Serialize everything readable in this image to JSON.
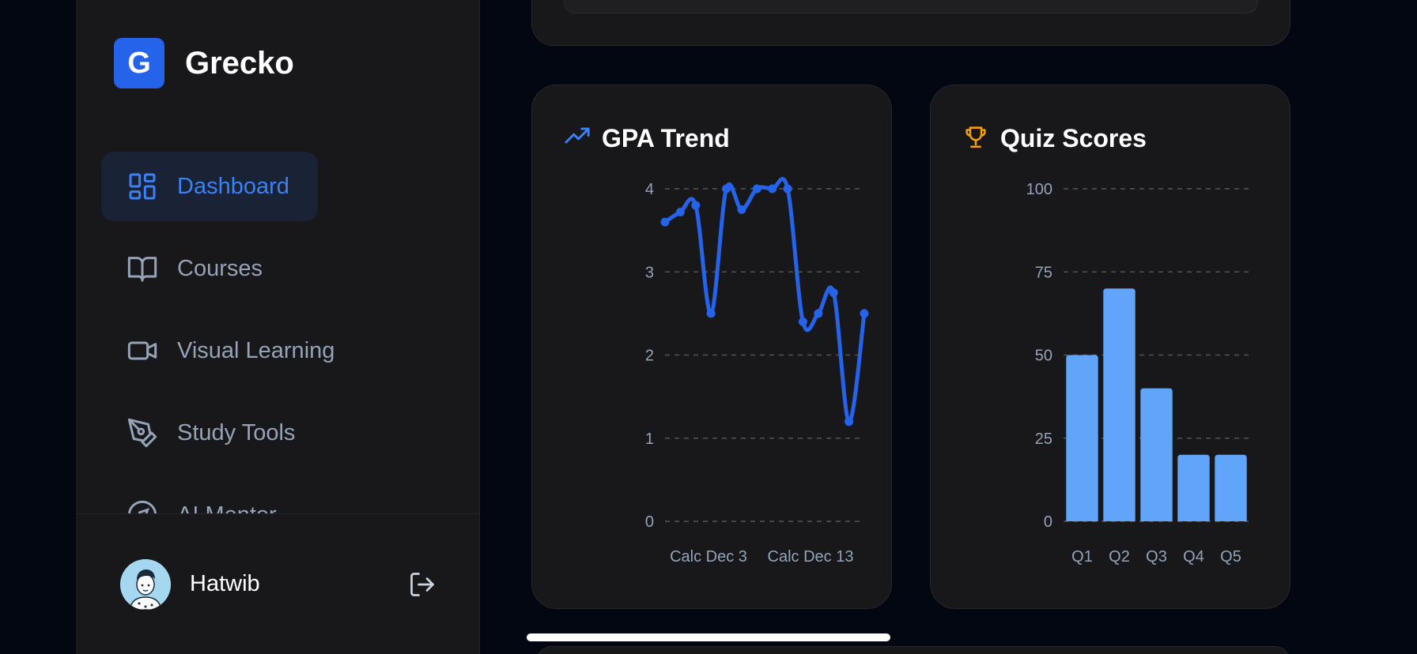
{
  "brand": {
    "logo_letter": "G",
    "name": "Grecko",
    "accent": "#2563eb"
  },
  "nav": {
    "items": [
      {
        "label": "Dashboard",
        "icon": "dashboard-icon",
        "active": true
      },
      {
        "label": "Courses",
        "icon": "book-icon",
        "active": false
      },
      {
        "label": "Visual Learning",
        "icon": "video-icon",
        "active": false
      },
      {
        "label": "Study Tools",
        "icon": "pen-tool-icon",
        "active": false
      },
      {
        "label": "AI Mentor",
        "icon": "compass-icon",
        "active": false
      }
    ]
  },
  "user": {
    "name": "Hatwib",
    "avatar": "avatar-illustration",
    "logout_icon": "logout-icon"
  },
  "gpa_card": {
    "title": "GPA Trend",
    "icon": "trending-up-icon"
  },
  "quiz_card": {
    "title": "Quiz Scores",
    "icon": "trophy-icon"
  },
  "chart_data": [
    {
      "type": "line",
      "title": "GPA Trend",
      "ylim": [
        0,
        4
      ],
      "yticks": [
        "0",
        "1",
        "2",
        "3",
        "4"
      ],
      "x_tick_labels": [
        "Calc Dec 3",
        "Calc Dec 13"
      ],
      "values": [
        3.6,
        3.72,
        3.8,
        2.5,
        4.0,
        3.75,
        4.0,
        4.0,
        4.0,
        2.4,
        2.5,
        2.75,
        1.2,
        2.5
      ],
      "color": "#2563eb",
      "grid": true
    },
    {
      "type": "bar",
      "title": "Quiz Scores",
      "categories": [
        "Q1",
        "Q2",
        "Q3",
        "Q4",
        "Q5"
      ],
      "values": [
        50,
        70,
        40,
        20,
        20
      ],
      "ylim": [
        0,
        100
      ],
      "yticks": [
        "0",
        "25",
        "50",
        "75",
        "100"
      ],
      "color": "#60a5fa",
      "grid": true
    }
  ]
}
